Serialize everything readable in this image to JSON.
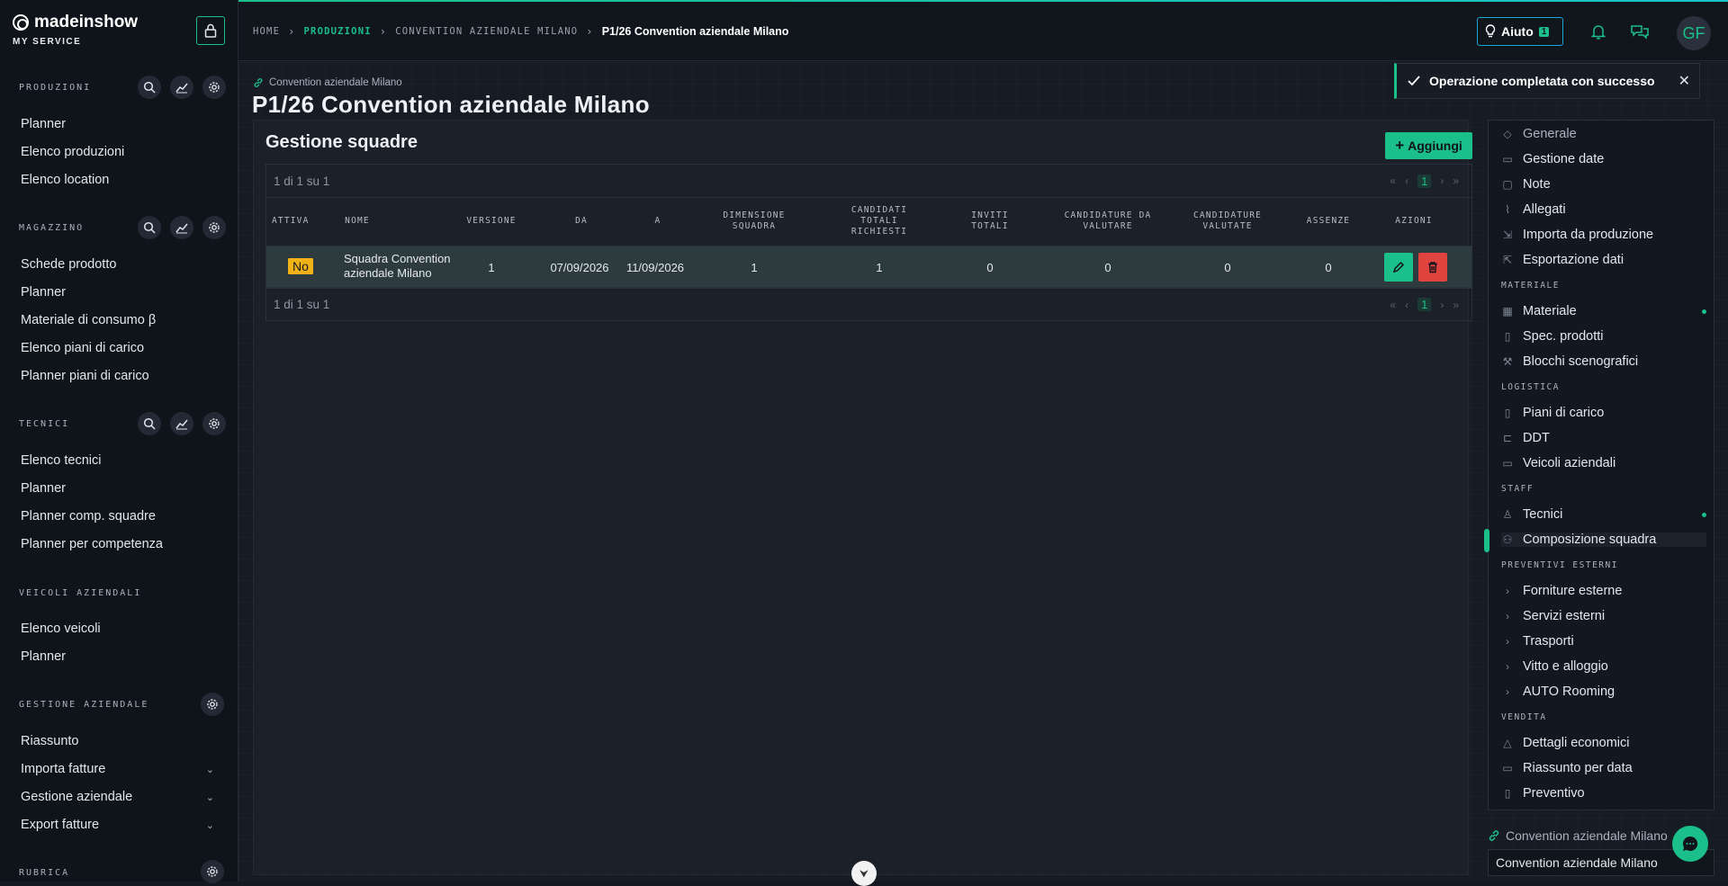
{
  "app": {
    "brand": "madeinshow",
    "subtitle": "MY SERVICE"
  },
  "colors": {
    "accent": "#1bbf8a",
    "danger": "#e0443f",
    "warning": "#f0b216",
    "background": "#141821"
  },
  "sidebar": {
    "sections": [
      {
        "title": "PRODUZIONI",
        "items": [
          "Planner",
          "Elenco produzioni",
          "Elenco location"
        ]
      },
      {
        "title": "MAGAZZINO",
        "items": [
          "Schede prodotto",
          "Planner",
          "Materiale di consumo β",
          "Elenco piani di carico",
          "Planner piani di carico"
        ]
      },
      {
        "title": "TECNICI",
        "items": [
          "Elenco tecnici",
          "Planner",
          "Planner comp. squadre",
          "Planner per competenza"
        ]
      },
      {
        "title": "VEICOLI AZIENDALI",
        "items": [
          "Elenco veicoli",
          "Planner"
        ]
      },
      {
        "title": "GESTIONE AZIENDALE",
        "items": [
          "Riassunto",
          "Importa fatture",
          "Gestione aziendale",
          "Export fatture"
        ]
      },
      {
        "title": "RUBRICA",
        "items": []
      }
    ]
  },
  "topbar": {
    "breadcrumb": [
      "HOME",
      "PRODUZIONI",
      "CONVENTION AZIENDALE MILANO",
      "P1/26 Convention aziendale Milano"
    ],
    "help_label": "Aiuto",
    "help_count": "1",
    "avatar_initials": "GF"
  },
  "page": {
    "parent_link": "Convention aziendale Milano",
    "title": "P1/26 Convention aziendale Milano"
  },
  "panel": {
    "title": "Gestione squadre",
    "add_label": "Aggiungi",
    "pager_text": "1 di 1 su 1",
    "current_page": "1",
    "columns": [
      "ATTIVA",
      "NOME",
      "VERSIONE",
      "DA",
      "A",
      "DIMENSIONE SQUADRA",
      "CANDIDATI TOTALI RICHIESTI",
      "INVITI TOTALI",
      "CANDIDATURE DA VALUTARE",
      "CANDIDATURE VALUTATE",
      "ASSENZE",
      "AZIONI"
    ],
    "rows": [
      {
        "attiva": "No",
        "nome": "Squadra Convention aziendale Milano",
        "versione": "1",
        "da": "07/09/2026",
        "a": "11/09/2026",
        "dimensione": "1",
        "candidati": "1",
        "inviti": "0",
        "da_valutare": "0",
        "valutate": "0",
        "assenze": "0"
      }
    ]
  },
  "right_nav": {
    "groups": [
      {
        "title": "",
        "items": [
          {
            "label": "Generale",
            "icon": "tag-icon"
          },
          {
            "label": "Gestione date",
            "icon": "calendar-icon"
          },
          {
            "label": "Note",
            "icon": "note-icon"
          },
          {
            "label": "Allegati",
            "icon": "paperclip-icon"
          },
          {
            "label": "Importa da produzione",
            "icon": "import-icon"
          },
          {
            "label": "Esportazione dati",
            "icon": "export-icon"
          }
        ]
      },
      {
        "title": "MATERIALE",
        "items": [
          {
            "label": "Materiale",
            "icon": "boxes-icon",
            "dot": true
          },
          {
            "label": "Spec. prodotti",
            "icon": "file-icon"
          },
          {
            "label": "Blocchi scenografici",
            "icon": "hammer-icon"
          }
        ]
      },
      {
        "title": "LOGISTICA",
        "items": [
          {
            "label": "Piani di carico",
            "icon": "clipboard-icon"
          },
          {
            "label": "DDT",
            "icon": "forklift-icon"
          },
          {
            "label": "Veicoli aziendali",
            "icon": "truck-icon"
          }
        ]
      },
      {
        "title": "STAFF",
        "items": [
          {
            "label": "Tecnici",
            "icon": "user-icon",
            "dot": true
          },
          {
            "label": "Composizione squadra",
            "icon": "team-icon",
            "active": true
          }
        ]
      },
      {
        "title": "PREVENTIVI ESTERNI",
        "items": [
          {
            "label": "Forniture esterne",
            "icon": "chevron-right-icon"
          },
          {
            "label": "Servizi esterni",
            "icon": "chevron-right-icon"
          },
          {
            "label": "Trasporti",
            "icon": "chevron-right-icon"
          },
          {
            "label": "Vitto e alloggio",
            "icon": "chevron-right-icon"
          },
          {
            "label": "AUTO Rooming",
            "icon": "chevron-right-icon"
          }
        ]
      },
      {
        "title": "VENDITA",
        "items": [
          {
            "label": "Dettagli economici",
            "icon": "money-bag-icon"
          },
          {
            "label": "Riassunto per data",
            "icon": "calendar-icon"
          },
          {
            "label": "Preventivo",
            "icon": "document-icon"
          }
        ]
      }
    ]
  },
  "toast": {
    "message": "Operazione completata con successo"
  },
  "footer": {
    "link_label": "Convention aziendale Milano",
    "select_value": "Convention aziendale Milano"
  }
}
